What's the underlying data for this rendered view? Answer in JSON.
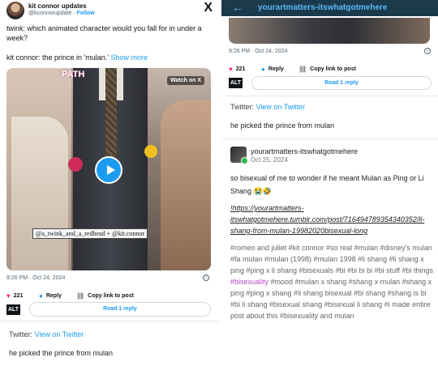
{
  "left_tweet": {
    "account_name": "kit connor updates",
    "handle": "@kconnorupdate",
    "follow_sep": " · ",
    "follow_label": "Follow",
    "x_logo": "X",
    "text_line1": "twink: which animated character would you fall for in under a week?",
    "text_line2": "kit connor: the prince in 'mulan.'",
    "show_more": "Show more",
    "video": {
      "watch_label": "Watch on X",
      "sign_text": "PATH",
      "caption": "@a_twink_and_a_redhead + @kit.connor"
    },
    "timestamp": "9:26 PM · Oct 24, 2024",
    "likes": "221",
    "reply_label": "Reply",
    "copy_label": "Copy link to post",
    "alt_label": "ALT",
    "read_reply": "Read 1 reply",
    "twitter_prefix": "Twitter: ",
    "twitter_view": "View on Twitter",
    "comment": "he picked the prince from mulan"
  },
  "right_panel": {
    "header_title": "yourartmatters-itswhatgotmehere",
    "timestamp": "9:26 PM · Oct 24, 2024",
    "likes": "221",
    "reply_label": "Reply",
    "copy_label": "Copy link to post",
    "alt_label": "ALT",
    "read_reply": "Read 1 reply",
    "twitter_prefix": "Twitter: ",
    "twitter_view": "View on Twitter",
    "comment": "he picked the prince from mulan",
    "post": {
      "author": "yourartmatters-itswhatgotmehere",
      "date": "Oct 25, 2024",
      "body": "so bisexual of me to wonder if he meant Mulan as Ping or Li Shang 😭🤣",
      "link": "!https://yourartmatters-itswhatgotmehere.tumblr.com/post/716494789354340352/li-shang-from-mulan-19982020bisexual-long",
      "tags_before": "#romeo and juliet   #kit connor   #so real   #mulan   #disney's mulan   #fa mulan   #mulan (1998)   #mulan 1998   #li shang   #li shang x ping   #ping x li shang   #bisexuals   #bi   #bi bi bi   #bi stuff   #bi things   ",
      "tag_highlight": "#bisexuality",
      "tags_after": "   #mood   #mulan x shang   #shang x mulan   #shang x ping   #ping x shang   #li shang bisexual   #bi shang   #shang is bi   #bi li shang   #bisexual shang   #bisexual li shang   #i made entire post about this   #bisexuality and mulan"
    }
  },
  "colors": {
    "accent": "#1d9bf0",
    "heart": "#f91880",
    "header_bg": "#1b3a4c",
    "header_text": "#5bb8f5",
    "tag_highlight": "#b44ec5"
  }
}
